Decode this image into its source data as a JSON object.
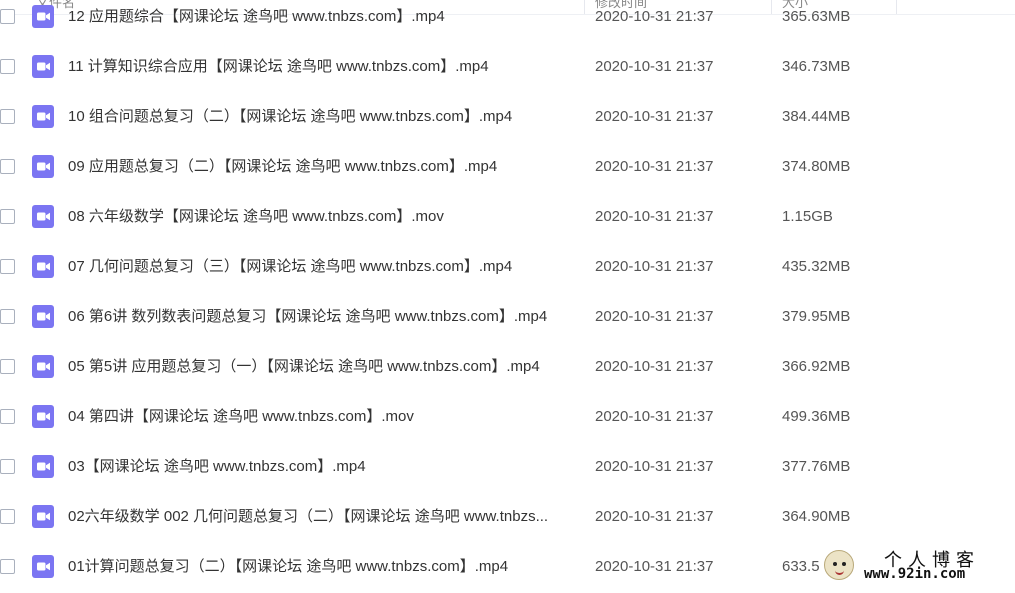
{
  "header": {
    "name_label": "文件名",
    "date_label": "修改时间",
    "size_label": "大小"
  },
  "files": [
    {
      "name": "12 应用题综合【网课论坛 途鸟吧 www.tnbzs.com】.mp4",
      "date": "2020-10-31 21:37",
      "size": "365.63MB"
    },
    {
      "name": "11 计算知识综合应用【网课论坛 途鸟吧 www.tnbzs.com】.mp4",
      "date": "2020-10-31 21:37",
      "size": "346.73MB"
    },
    {
      "name": "10 组合问题总复习（二）【网课论坛 途鸟吧 www.tnbzs.com】.mp4",
      "date": "2020-10-31 21:37",
      "size": "384.44MB"
    },
    {
      "name": "09 应用题总复习（二）【网课论坛 途鸟吧 www.tnbzs.com】.mp4",
      "date": "2020-10-31 21:37",
      "size": "374.80MB"
    },
    {
      "name": "08 六年级数学【网课论坛 途鸟吧 www.tnbzs.com】.mov",
      "date": "2020-10-31 21:37",
      "size": "1.15GB"
    },
    {
      "name": "07 几何问题总复习（三）【网课论坛 途鸟吧 www.tnbzs.com】.mp4",
      "date": "2020-10-31 21:37",
      "size": "435.32MB"
    },
    {
      "name": "06 第6讲 数列数表问题总复习【网课论坛 途鸟吧 www.tnbzs.com】.mp4",
      "date": "2020-10-31 21:37",
      "size": "379.95MB"
    },
    {
      "name": "05 第5讲 应用题总复习（一）【网课论坛 途鸟吧 www.tnbzs.com】.mp4",
      "date": "2020-10-31 21:37",
      "size": "366.92MB"
    },
    {
      "name": "04 第四讲【网课论坛 途鸟吧 www.tnbzs.com】.mov",
      "date": "2020-10-31 21:37",
      "size": "499.36MB"
    },
    {
      "name": "03【网课论坛 途鸟吧 www.tnbzs.com】.mp4",
      "date": "2020-10-31 21:37",
      "size": "377.76MB"
    },
    {
      "name": "02六年级数学 002 几何问题总复习（二）【网课论坛 途鸟吧 www.tnbzs...",
      "date": "2020-10-31 21:37",
      "size": "364.90MB"
    },
    {
      "name": "01计算问题总复习（二）【网课论坛 途鸟吧 www.tnbzs.com】.mp4",
      "date": "2020-10-31 21:37",
      "size": "633.5"
    }
  ],
  "watermark": {
    "title": "个人博客",
    "url": "www.92in.com"
  },
  "icons": {
    "file": "video-file-icon"
  },
  "colors": {
    "video_icon": "#7b75f2",
    "text": "#333333",
    "muted": "#555555"
  }
}
